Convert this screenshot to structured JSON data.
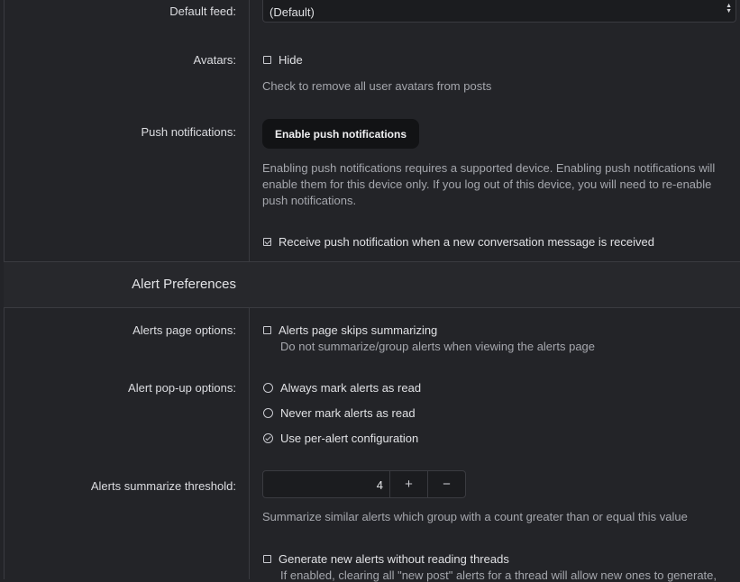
{
  "default_feed": {
    "label": "Default feed:",
    "value": "(Default)"
  },
  "avatars": {
    "label": "Avatars:",
    "option_label": "Hide",
    "hint": "Check to remove all user avatars from posts"
  },
  "push": {
    "label": "Push notifications:",
    "button_label": "Enable push notifications",
    "hint_line1": "Enabling push notifications requires a supported device. Enabling push notifications will",
    "hint_line2": "enable them for this device only. If you log out of this device, you will need to re-enable",
    "hint_line3": "push notifications.",
    "conversation_option": "Receive push notification when a new conversation message is received"
  },
  "alert_section": {
    "title": "Alert Preferences"
  },
  "alerts_page": {
    "label": "Alerts page options:",
    "option_label": "Alerts page skips summarizing",
    "hint": "Do not summarize/group alerts when viewing the alerts page"
  },
  "popup": {
    "label": "Alert pop-up options:",
    "options": [
      "Always mark alerts as read",
      "Never mark alerts as read",
      "Use per-alert configuration"
    ]
  },
  "threshold": {
    "label": "Alerts summarize threshold:",
    "value": "4",
    "plus": "+",
    "minus": "−",
    "hint": "Summarize similar alerts which group with a count greater than or equal this value"
  },
  "generate": {
    "option_label": "Generate new alerts without reading threads",
    "hint": "If enabled, clearing all \"new post\" alerts for a thread will allow new ones to generate,"
  }
}
